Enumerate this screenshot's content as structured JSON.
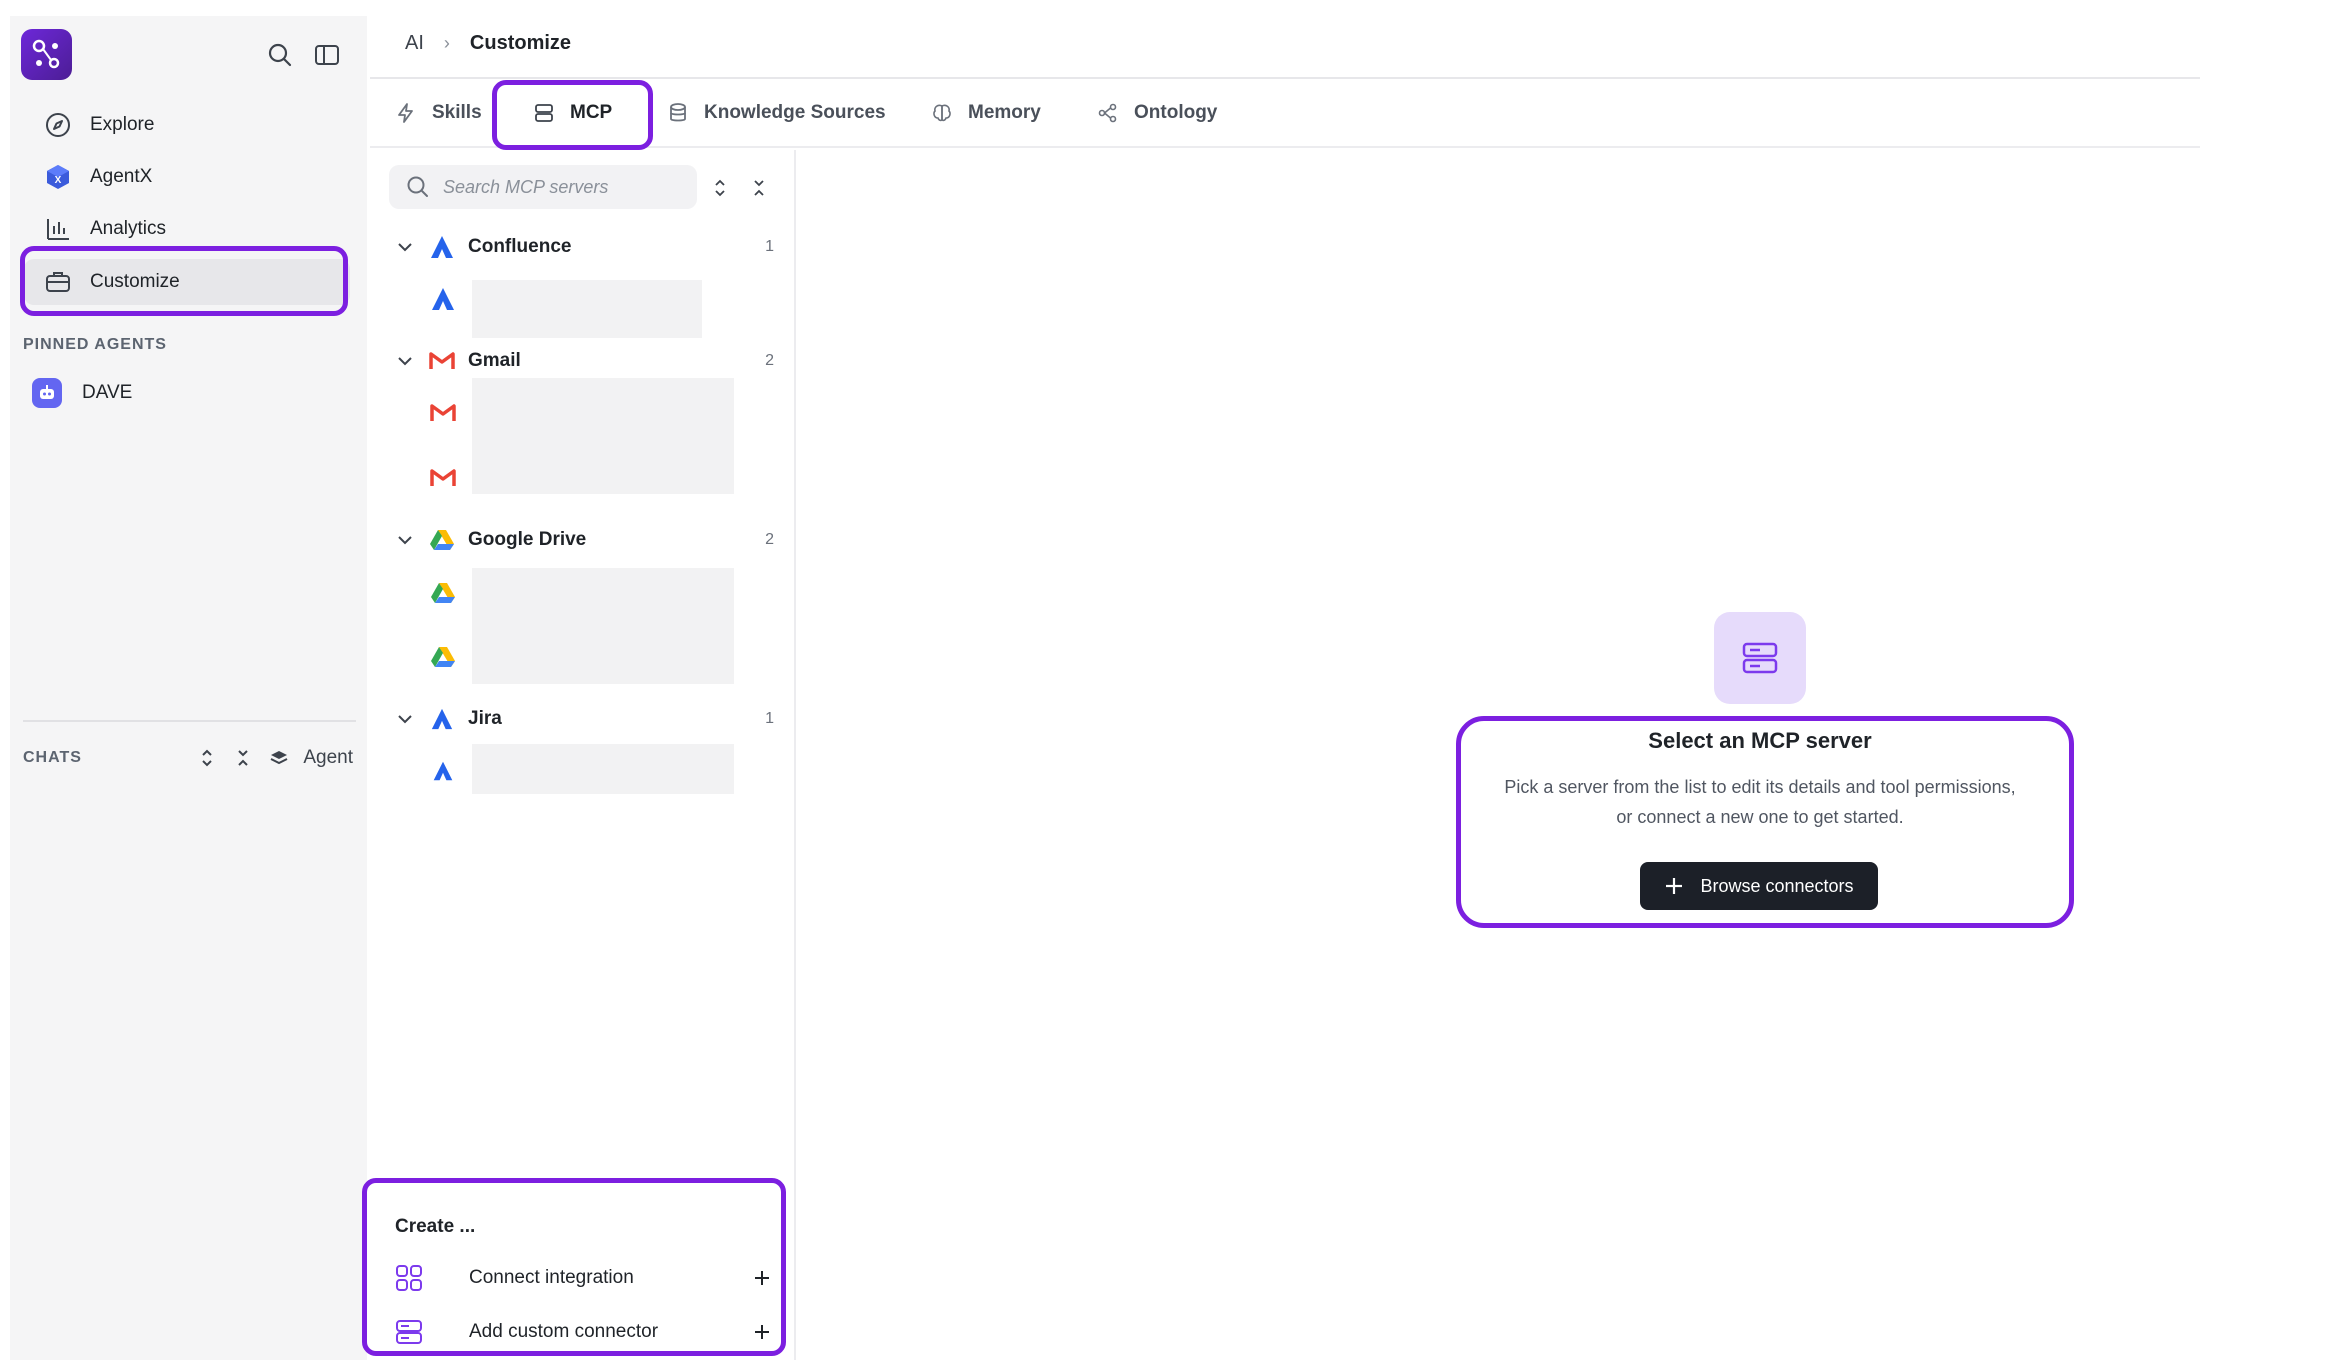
{
  "sidebar": {
    "nav": [
      {
        "label": "Explore",
        "icon": "compass-icon"
      },
      {
        "label": "AgentX",
        "icon": "agentx-cube-icon"
      },
      {
        "label": "Analytics",
        "icon": "bar-chart-icon"
      },
      {
        "label": "Customize",
        "icon": "briefcase-icon",
        "active": true
      }
    ],
    "pinned_label": "PINNED AGENTS",
    "pinned_agents": [
      {
        "label": "DAVE",
        "icon": "robot-icon"
      }
    ],
    "chats_label": "CHATS",
    "chats_filter": "Agent"
  },
  "breadcrumb": {
    "parent": "AI",
    "current": "Customize"
  },
  "tabs": [
    {
      "label": "Skills",
      "icon": "lightning-icon"
    },
    {
      "label": "MCP",
      "icon": "server-icon",
      "active": true
    },
    {
      "label": "Knowledge Sources",
      "icon": "database-icon"
    },
    {
      "label": "Memory",
      "icon": "brain-icon"
    },
    {
      "label": "Ontology",
      "icon": "network-icon"
    }
  ],
  "server_list": {
    "search_placeholder": "Search MCP servers",
    "groups": [
      {
        "name": "Confluence",
        "count": "1",
        "icon": "confluence-icon"
      },
      {
        "name": "Gmail",
        "count": "2",
        "icon": "gmail-icon"
      },
      {
        "name": "Google Drive",
        "count": "2",
        "icon": "google-drive-icon"
      },
      {
        "name": "Jira",
        "count": "1",
        "icon": "jira-icon"
      }
    ]
  },
  "create": {
    "title": "Create ...",
    "items": [
      {
        "label": "Connect integration",
        "icon": "grid-icon"
      },
      {
        "label": "Add custom connector",
        "icon": "server-icon"
      }
    ]
  },
  "empty_state": {
    "title": "Select an MCP server",
    "description_line1": "Pick a server from the list to edit its details and tool permissions,",
    "description_line2": "or connect a new one to get started.",
    "button_label": "Browse connectors"
  },
  "colors": {
    "accent": "#7c1fe0",
    "button_dark": "#1c2028",
    "icon_bg": "#e6dbfb"
  }
}
